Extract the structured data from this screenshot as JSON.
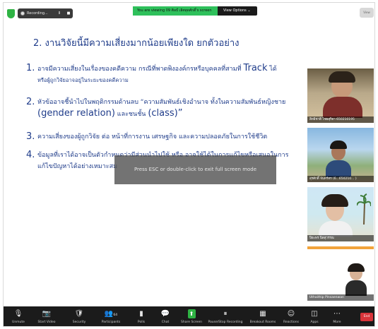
{
  "topbar": {
    "recording_label": "Recording...",
    "pause_glyph": "II",
    "stop_glyph": "■",
    "viewing_text": "You are viewing 09 ศิลป์ เลิศสุดศักดิ์'s screen",
    "view_options": "View Options ⌄",
    "view_button": "View"
  },
  "slide": {
    "title": "2. งานวิจัยนี้มีความเสี่ยงมากน้อยเพียงใด ยกตัวอย่าง",
    "items": [
      {
        "num": "1.",
        "line1": "อาจมีความเสี่ยงในเรื่องของคดีความ กรณีที่พาดพิงองค์กรหรือบุคคลที่สามที่",
        "line1_en": "Track",
        "line1_end": "ได้",
        "line2": "หรือผู้ถูกวิจัยอาจอยู่ในระยะของคดีความ"
      },
      {
        "num": "2.",
        "line1": "หัวข้ออาจชี้นำไปในพฤติกรรมด้านลบ “ความสัมพันธ์เชิงอำนาจ ทั้งในความสัมพันธ์หญิงชาย",
        "line2_en": "(gender relation)",
        "line2_mid": "และชนชั้น",
        "line2_end": "(class)”"
      },
      {
        "num": "3.",
        "line1": "ความเสี่ยงของผู้ถูกวิจัย ต่อ หน้าที่การงาน เศรษฐกิจ และความปลอดภัยในการใช้ชีวิต"
      },
      {
        "num": "4.",
        "line1": "ข้อมูลที่เราได้อาจเป็นตัวกำหนดว่ามีส่วนนำไปใช้ หรือ อาจใช้ได้ในการแก้ไขหรือเสนอในการ",
        "line2": "แก้ไขปัญหาได้อย่างเหมาะสม"
      }
    ],
    "esc_toast": "Press ESC or double-click to exit full screen mode"
  },
  "tiles": [
    {
      "name": "สิทธิชาติ ไชยสุริยา 650210195"
    },
    {
      "name": "สุรศักดิ์ จันทร์ทร (6...650210... )"
    },
    {
      "name": "ปิยะพร นิลสุวรรณ"
    },
    {
      "name": "Uthaithip Pinsaenwan"
    }
  ],
  "toolbar": {
    "items": [
      {
        "label": "Unmute",
        "icon": "🎙"
      },
      {
        "label": "Start Video",
        "icon": "📷"
      },
      {
        "label": "Security",
        "icon": "🛡"
      },
      {
        "label": "Participants",
        "icon": "👥",
        "count": "64"
      },
      {
        "label": "Polls",
        "icon": "▮"
      },
      {
        "label": "Chat",
        "icon": "💬"
      },
      {
        "label": "Share Screen",
        "icon": "⬆"
      },
      {
        "label": "Pause/Stop Recording",
        "icon": "⏸"
      },
      {
        "label": "Breakout Rooms",
        "icon": "▦"
      },
      {
        "label": "Reactions",
        "icon": "☺"
      },
      {
        "label": "Apps",
        "icon": "◫"
      },
      {
        "label": "More",
        "icon": "⋯"
      }
    ],
    "end_label": "End"
  }
}
